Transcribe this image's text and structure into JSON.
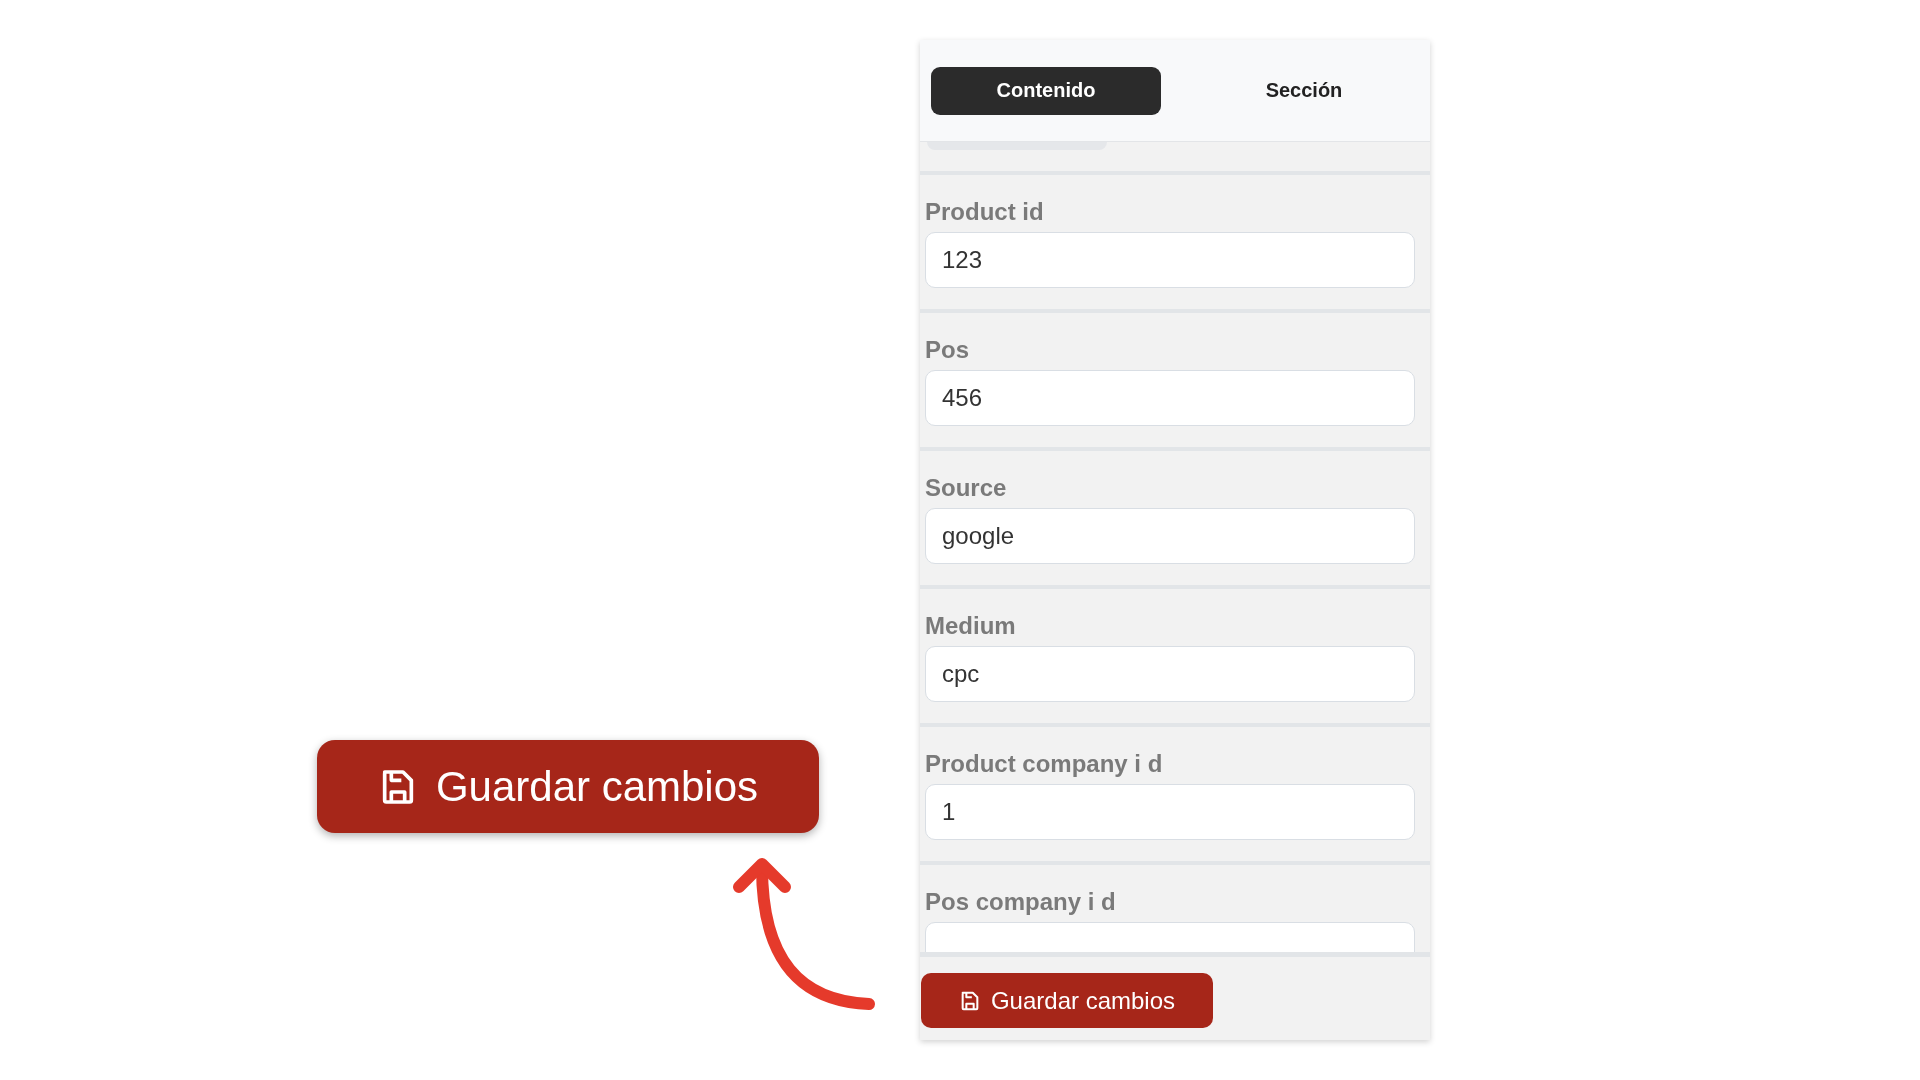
{
  "tabs": [
    {
      "label": "Contenido",
      "selected": true
    },
    {
      "label": "Sección",
      "selected": false
    }
  ],
  "fields": [
    {
      "label": "Product id",
      "value": "123"
    },
    {
      "label": "Pos",
      "value": "456"
    },
    {
      "label": "Source",
      "value": "google"
    },
    {
      "label": "Medium",
      "value": "cpc"
    },
    {
      "label": "Product company i d",
      "value": "1"
    },
    {
      "label": "Pos company i d"
    }
  ],
  "save_button": {
    "label": "Guardar cambios"
  },
  "callout_button": {
    "label": "Guardar cambios"
  }
}
